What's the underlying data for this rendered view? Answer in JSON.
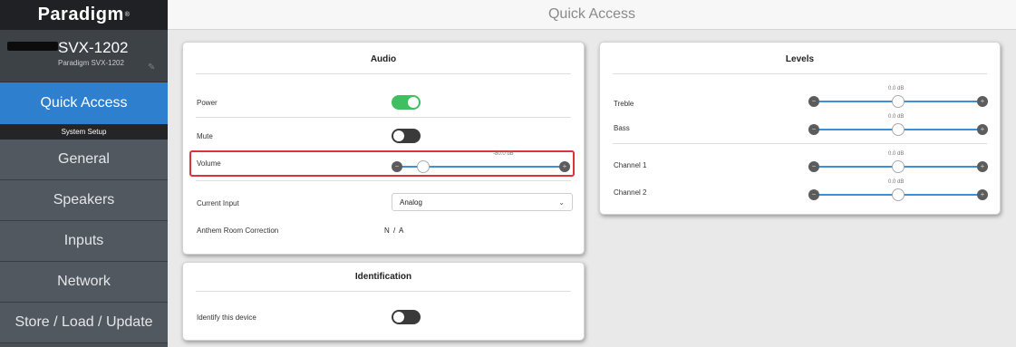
{
  "brand": {
    "name": "Paradigm",
    "mark": "®"
  },
  "device": {
    "name": "SVX-1202",
    "model": "Paradigm SVX-1202"
  },
  "sidebar": {
    "active_item": "Quick Access",
    "section_label": "System Setup",
    "items": [
      "General",
      "Speakers",
      "Inputs",
      "Network",
      "Store / Load / Update"
    ]
  },
  "header": {
    "title": "Quick Access"
  },
  "audio": {
    "title": "Audio",
    "power_label": "Power",
    "power_on": true,
    "mute_label": "Mute",
    "mute_on": false,
    "volume_label": "Volume",
    "volume_value": "-80.0 dB",
    "volume_fraction": 0.13,
    "input_label": "Current Input",
    "input_value": "Analog",
    "arc_label": "Anthem Room Correction",
    "arc_value": "N / A"
  },
  "identification": {
    "title": "Identification",
    "identify_label": "Identify this device",
    "identify_on": false
  },
  "levels": {
    "title": "Levels",
    "rows": [
      {
        "label": "Treble",
        "value": "0.0 dB",
        "fraction": 0.5
      },
      {
        "label": "Bass",
        "value": "0.0 dB",
        "fraction": 0.5
      },
      {
        "label": "Channel 1",
        "value": "0.0 dB",
        "fraction": 0.5
      },
      {
        "label": "Channel 2",
        "value": "0.0 dB",
        "fraction": 0.5
      }
    ]
  },
  "slider_symbols": {
    "minus": "−",
    "plus": "+"
  },
  "colors": {
    "accent": "#2e7fce",
    "toggle_on": "#3fbf5f",
    "highlight": "#d9343a",
    "slider_track": "#3d8fd6"
  }
}
